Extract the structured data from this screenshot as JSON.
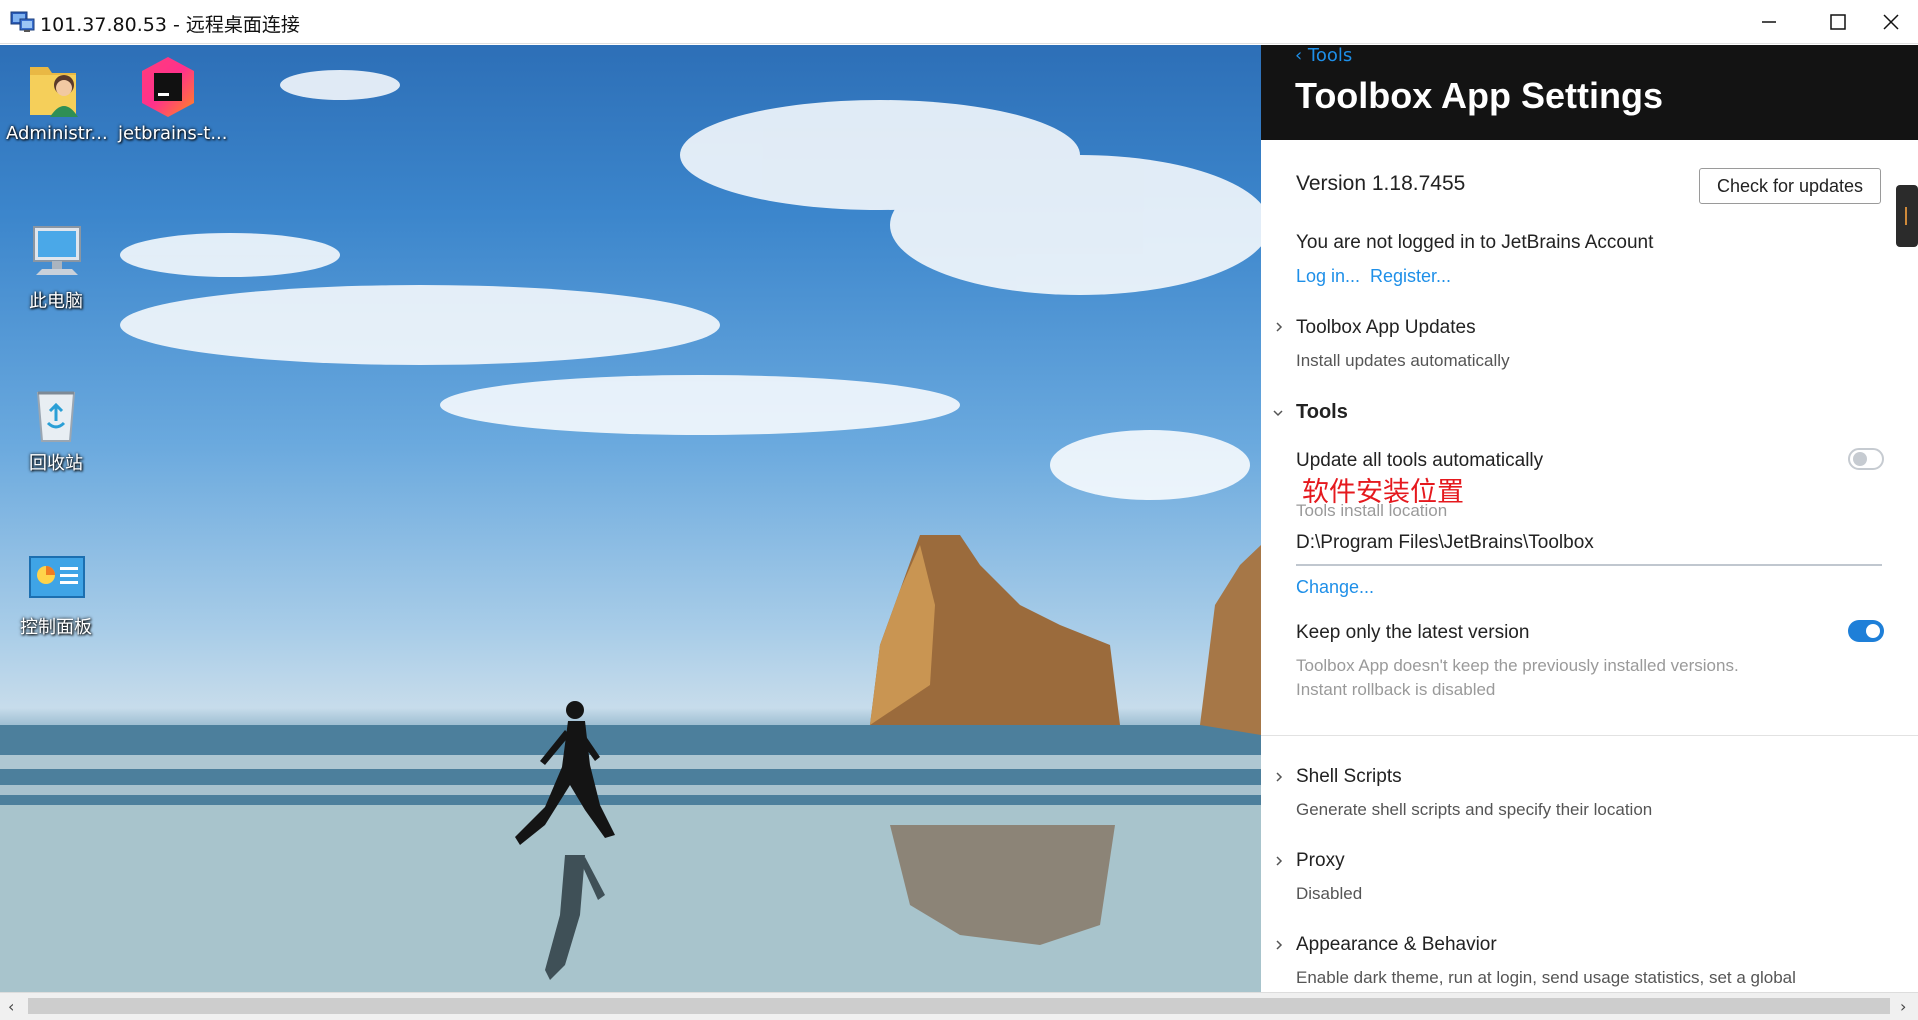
{
  "window": {
    "title": "101.37.80.53 - 远程桌面连接",
    "icon": "rdp-connection-icon",
    "controls": [
      "minimize-icon",
      "maximize-icon",
      "close-icon"
    ]
  },
  "desktop": {
    "icons": [
      {
        "label": "Administr...",
        "icon": "user-folder-icon"
      },
      {
        "label": "jetbrains-t...",
        "icon": "jetbrains-toolbox-icon"
      },
      {
        "label": "此电脑",
        "icon": "this-pc-icon"
      },
      {
        "label": "回收站",
        "icon": "recycle-bin-icon"
      },
      {
        "label": "控制面板",
        "icon": "control-panel-icon"
      }
    ]
  },
  "settings": {
    "back_label": "Tools",
    "title": "Toolbox App Settings",
    "version": "Version 1.18.7455",
    "check_updates_label": "Check for updates",
    "account_status": "You are not logged in to JetBrains Account",
    "login_label": "Log in...",
    "register_label": "Register...",
    "sections": {
      "app_updates": {
        "title": "Toolbox App Updates",
        "subtitle": "Install updates automatically"
      },
      "tools": {
        "title": "Tools",
        "update_all_label": "Update all tools automatically",
        "update_all_enabled": false,
        "annotation": "软件安装位置",
        "install_location_label": "Tools install location",
        "install_location_value": "D:\\Program Files\\JetBrains\\Toolbox",
        "change_label": "Change...",
        "keep_latest_label": "Keep only the latest version",
        "keep_latest_enabled": true,
        "keep_latest_desc_1": "Toolbox App doesn't keep the previously installed versions.",
        "keep_latest_desc_2": "Instant rollback is disabled"
      },
      "shell_scripts": {
        "title": "Shell Scripts",
        "subtitle": "Generate shell scripts and specify their location"
      },
      "proxy": {
        "title": "Proxy",
        "subtitle": "Disabled"
      },
      "appearance": {
        "title": "Appearance & Behavior",
        "subtitle": "Enable dark theme, run at login, send usage statistics, set a global"
      }
    }
  },
  "colors": {
    "accent": "#1e8fe8",
    "header_bg": "#131313",
    "annotation": "#e5191e",
    "toggle_on": "#1e7fd8"
  }
}
